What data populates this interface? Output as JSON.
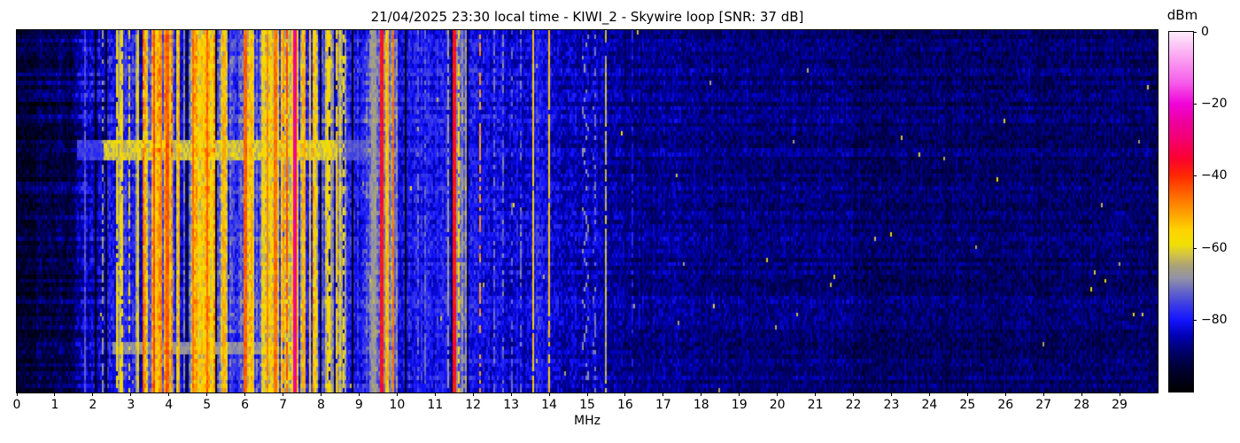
{
  "title": "21/04/2025 23:30 local time - KIWI_2 - Skywire loop [SNR: 37 dB]",
  "axes": {
    "x_label": "MHz",
    "x_range": [
      0,
      30
    ],
    "x_ticks": [
      0,
      1,
      2,
      3,
      4,
      5,
      6,
      7,
      8,
      9,
      10,
      11,
      12,
      13,
      14,
      15,
      16,
      17,
      18,
      19,
      20,
      21,
      22,
      23,
      24,
      25,
      26,
      27,
      28,
      29
    ],
    "y_ticks": []
  },
  "colorbar": {
    "label": "dBm",
    "tick_labels": [
      "0",
      "−20",
      "−40",
      "−60",
      "−80"
    ],
    "tick_values": [
      0,
      -20,
      -40,
      -60,
      -80
    ],
    "range": [
      -100,
      0
    ],
    "stops": [
      [
        0.0,
        "#000000"
      ],
      [
        0.055,
        "#00002a"
      ],
      [
        0.11,
        "#000068"
      ],
      [
        0.155,
        "#0000b4"
      ],
      [
        0.2,
        "#1414ff"
      ],
      [
        0.24,
        "#3a3ae6"
      ],
      [
        0.28,
        "#6666c8"
      ],
      [
        0.315,
        "#9292a8"
      ],
      [
        0.35,
        "#aaa276"
      ],
      [
        0.385,
        "#d8c83c"
      ],
      [
        0.41,
        "#f0e000"
      ],
      [
        0.45,
        "#ffd200"
      ],
      [
        0.5,
        "#ff9c00"
      ],
      [
        0.55,
        "#ff6400"
      ],
      [
        0.6,
        "#ff2800"
      ],
      [
        0.65,
        "#fa0032"
      ],
      [
        0.7,
        "#f4006e"
      ],
      [
        0.75,
        "#ee009e"
      ],
      [
        0.8,
        "#f004d8"
      ],
      [
        0.86,
        "#f65eea"
      ],
      [
        0.93,
        "#faa4f2"
      ],
      [
        1.0,
        "#fcecfa"
      ]
    ]
  },
  "chart_data": {
    "type": "heatmap",
    "title": "21/04/2025 23:30 local time - KIWI_2 - Skywire loop [SNR: 37 dB]",
    "xlabel": "MHz",
    "ylabel": "",
    "x_range": [
      0,
      30
    ],
    "value_unit": "dBm",
    "value_range": [
      -100,
      0
    ],
    "y_axis_note": "time (waterfall rows, no tick labels shown)",
    "snr_db": 37,
    "noise_floor_profile": [
      [
        0.0,
        0.5,
        -93,
        1,
        4,
        0
      ],
      [
        0.5,
        1.55,
        -90,
        2,
        4.5,
        0
      ],
      [
        1.55,
        2.35,
        -84,
        3,
        5,
        0.06
      ],
      [
        2.35,
        2.55,
        -79,
        3,
        5,
        0.1
      ],
      [
        2.55,
        2.75,
        -62,
        6,
        5,
        0.25
      ],
      [
        2.75,
        3.1,
        -78,
        3,
        5,
        0.08
      ],
      [
        3.1,
        3.3,
        -64,
        6,
        5,
        0.2
      ],
      [
        3.3,
        4.15,
        -54,
        7,
        5,
        0.16
      ],
      [
        4.15,
        4.4,
        -62,
        7,
        5,
        0.25
      ],
      [
        4.4,
        4.62,
        -70,
        6,
        5,
        0.3
      ],
      [
        4.62,
        5.2,
        -56,
        7,
        5,
        0.18
      ],
      [
        5.2,
        5.38,
        -74,
        4,
        5,
        0.15
      ],
      [
        5.38,
        5.58,
        -61,
        6,
        5,
        0.2
      ],
      [
        5.58,
        5.95,
        -75,
        4,
        5,
        0.1
      ],
      [
        5.95,
        6.25,
        -55,
        7,
        5,
        0.15
      ],
      [
        6.25,
        6.45,
        -73,
        5,
        5,
        0.2
      ],
      [
        6.45,
        7.25,
        -56,
        7,
        5,
        0.18
      ],
      [
        7.25,
        7.42,
        -55,
        6,
        5,
        0.1
      ],
      [
        7.42,
        7.95,
        -59,
        7,
        5,
        0.22
      ],
      [
        7.95,
        8.12,
        -75,
        4,
        5,
        0.1
      ],
      [
        8.12,
        8.68,
        -65,
        6,
        5,
        0.25
      ],
      [
        8.68,
        9.2,
        -79,
        2.5,
        5,
        0.04
      ],
      [
        9.2,
        9.55,
        -72,
        3,
        5,
        0.05
      ],
      [
        9.55,
        10.0,
        -70,
        4,
        5,
        0.08
      ],
      [
        10.0,
        11.42,
        -80,
        2,
        4.5,
        0.02
      ],
      [
        11.42,
        11.9,
        -70,
        5,
        5,
        0.12
      ],
      [
        11.9,
        12.12,
        -79,
        2.5,
        4.5,
        0.03
      ],
      [
        12.12,
        13.5,
        -82,
        2,
        4.5,
        0
      ],
      [
        13.5,
        14.08,
        -80,
        2.5,
        4.5,
        0.02
      ],
      [
        14.08,
        15.42,
        -84,
        1.5,
        4.5,
        0
      ],
      [
        15.42,
        16.0,
        -86,
        1.5,
        4,
        0
      ],
      [
        16.0,
        18.5,
        -87,
        1.5,
        4,
        0
      ],
      [
        18.5,
        22.0,
        -88,
        1.2,
        4,
        0
      ],
      [
        22.0,
        30.0,
        -89,
        1.2,
        4,
        0
      ]
    ],
    "signals": [
      {
        "f": 1.8,
        "w": 0.02,
        "level": -74,
        "duty": 0.85
      },
      {
        "f": 2.05,
        "w": 0.02,
        "level": -69,
        "duty": 0.5
      },
      {
        "f": 2.25,
        "w": 0.02,
        "level": -67,
        "duty": 0.55
      },
      {
        "f": 2.62,
        "w": 0.03,
        "level": -58,
        "duty": 0.9
      },
      {
        "f": 2.78,
        "w": 0.025,
        "level": -57,
        "duty": 0.85
      },
      {
        "f": 2.95,
        "w": 0.02,
        "level": -60,
        "duty": 0.5
      },
      {
        "f": 3.2,
        "w": 0.02,
        "level": -58,
        "duty": 0.6
      },
      {
        "f": 3.33,
        "w": 0.015,
        "level": -45,
        "duty": 0.9
      },
      {
        "f": 3.6,
        "w": 0.035,
        "level": -43,
        "duty": 1
      },
      {
        "f": 3.78,
        "w": 0.025,
        "level": -49,
        "duty": 1
      },
      {
        "f": 3.95,
        "w": 0.035,
        "level": -44,
        "duty": 1
      },
      {
        "f": 4.27,
        "w": 0.02,
        "level": -52,
        "duty": 0.8
      },
      {
        "f": 4.65,
        "w": 0.03,
        "level": -46,
        "duty": 1
      },
      {
        "f": 4.88,
        "w": 0.02,
        "level": -54,
        "duty": 0.9
      },
      {
        "f": 5.0,
        "w": 0.035,
        "level": -45,
        "duty": 1
      },
      {
        "f": 5.45,
        "w": 0.025,
        "level": -52,
        "duty": 0.9
      },
      {
        "f": 5.68,
        "w": 0.02,
        "level": -62,
        "duty": 0.4
      },
      {
        "f": 6.0,
        "w": 0.035,
        "level": -45,
        "duty": 1
      },
      {
        "f": 6.16,
        "w": 0.02,
        "level": -52,
        "duty": 0.85
      },
      {
        "f": 6.6,
        "w": 0.03,
        "level": -48,
        "duty": 1
      },
      {
        "f": 6.8,
        "w": 0.035,
        "level": -46,
        "duty": 1
      },
      {
        "f": 7.0,
        "w": 0.025,
        "level": -50,
        "duty": 0.9
      },
      {
        "f": 7.12,
        "w": 0.02,
        "level": -44,
        "duty": 0.9
      },
      {
        "f": 7.32,
        "w": 0.045,
        "level": -26,
        "duty": 1
      },
      {
        "f": 7.55,
        "w": 0.03,
        "level": -52,
        "duty": 0.9
      },
      {
        "f": 7.72,
        "w": 0.025,
        "level": -56,
        "duty": 0.8
      },
      {
        "f": 8.2,
        "w": 0.03,
        "level": -57,
        "duty": 0.85
      },
      {
        "f": 8.4,
        "w": 0.03,
        "level": -55,
        "duty": 0.9
      },
      {
        "f": 8.58,
        "w": 0.02,
        "level": -60,
        "duty": 0.5
      },
      {
        "f": 9.4,
        "w": 0.06,
        "level": -67,
        "duty": 1
      },
      {
        "f": 9.6,
        "w": 0.035,
        "level": -37,
        "duty": 1
      },
      {
        "f": 9.72,
        "w": 0.045,
        "level": -53,
        "duty": 1
      },
      {
        "f": 9.9,
        "w": 0.025,
        "level": -46,
        "duty": 1
      },
      {
        "f": 10.2,
        "w": 0.02,
        "level": -47,
        "duty": 1
      },
      {
        "f": 10.55,
        "w": 0.015,
        "level": -72,
        "duty": 0.5
      },
      {
        "f": 10.75,
        "w": 0.015,
        "level": -73,
        "duty": 0.45
      },
      {
        "f": 10.9,
        "w": 0.022,
        "level": -45,
        "duty": 0.2
      },
      {
        "f": 11.35,
        "w": 0.02,
        "level": -66,
        "duty": 0.8
      },
      {
        "f": 11.5,
        "w": 0.045,
        "level": -37,
        "duty": 1
      },
      {
        "f": 11.63,
        "w": 0.015,
        "level": -57,
        "duty": 0.6
      },
      {
        "f": 11.74,
        "w": 0.015,
        "level": -58,
        "duty": 0.55
      },
      {
        "f": 11.84,
        "w": 0.015,
        "level": -60,
        "duty": 0.5
      },
      {
        "f": 12.2,
        "w": 0.025,
        "level": -50,
        "duty": 0.6
      },
      {
        "f": 12.55,
        "w": 0.013,
        "level": -72,
        "duty": 0.5
      },
      {
        "f": 12.78,
        "w": 0.013,
        "level": -71,
        "duty": 0.45
      },
      {
        "f": 13.02,
        "w": 0.013,
        "level": -73,
        "duty": 0.45
      },
      {
        "f": 13.25,
        "w": 0.013,
        "level": -72,
        "duty": 0.4
      },
      {
        "f": 13.57,
        "w": 0.022,
        "level": -55,
        "duty": 0.95
      },
      {
        "f": 13.78,
        "w": 0.013,
        "level": -70,
        "duty": 0.45
      },
      {
        "f": 14.0,
        "w": 0.022,
        "level": -54,
        "duty": 0.95
      },
      {
        "f": 14.35,
        "w": 0.013,
        "level": -76,
        "duty": 0.4
      },
      {
        "f": 15.5,
        "w": 0.015,
        "level": -63,
        "duty": 0.85
      },
      {
        "f": 16.2,
        "w": 0.013,
        "level": -80,
        "duty": 0.5
      },
      {
        "f": 17.1,
        "w": 0.018,
        "level": -77,
        "duty": 0.9
      },
      {
        "f": 17.7,
        "w": 0.018,
        "level": -74,
        "duty": 0.6
      },
      {
        "f": 18.4,
        "w": 0.018,
        "level": -74,
        "duty": 0.55
      }
    ],
    "time_bands": [
      {
        "rows": [
          0.3,
          0.357
        ],
        "f": [
          2.3,
          8.45
        ],
        "min_level": -66,
        "jitter": 8
      },
      {
        "rows": [
          0.3,
          0.357
        ],
        "f": [
          1.6,
          2.3
        ],
        "min_level": -79,
        "jitter": 5
      },
      {
        "rows": [
          0.3,
          0.357
        ],
        "f": [
          8.45,
          9.6
        ],
        "min_level": -77,
        "jitter": 5
      },
      {
        "rows": [
          0.858,
          0.888
        ],
        "f": [
          2.5,
          6.6
        ],
        "min_level": -71,
        "jitter": 5
      }
    ],
    "ionosonde_traces": [
      {
        "f": 14.95,
        "wiggle": 0.06,
        "duty": 0.5,
        "level": -71
      },
      {
        "f": 15.2,
        "wiggle": 0.02,
        "duty": 0.4,
        "level": -73
      }
    ],
    "render": {
      "cols": 644,
      "rows": 86,
      "seed": 1337,
      "row_jitter_db": 1.8,
      "left_stripe_jitter_db": 3.5,
      "mid_stripe_jitter_db": 2.0,
      "speckle_prob": 0.0012
    }
  }
}
